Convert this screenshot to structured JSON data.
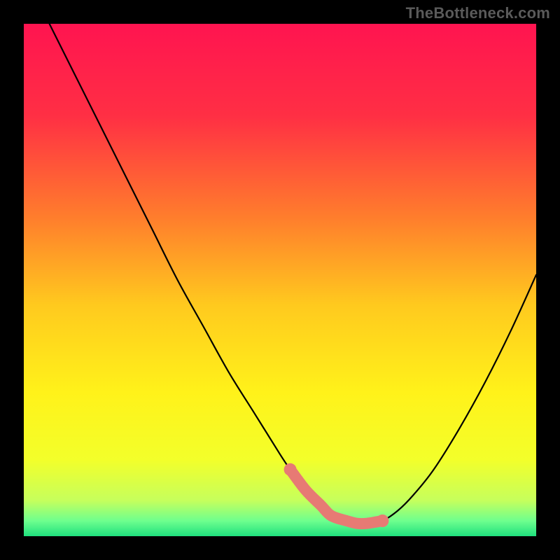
{
  "watermark": "TheBottleneck.com",
  "chart_data": {
    "type": "line",
    "title": "",
    "xlabel": "",
    "ylabel": "",
    "xlim": [
      0,
      100
    ],
    "ylim": [
      0,
      100
    ],
    "grid": false,
    "legend": false,
    "series": [
      {
        "name": "curve",
        "x": [
          5,
          10,
          15,
          20,
          25,
          30,
          35,
          40,
          45,
          50,
          52,
          55,
          58,
          60,
          63,
          65,
          67,
          70,
          73,
          76,
          80,
          85,
          90,
          95,
          100
        ],
        "values": [
          100,
          90,
          80,
          70,
          60,
          50,
          41,
          32,
          24,
          16,
          13,
          9,
          6,
          4,
          3,
          2.5,
          2.5,
          3,
          5,
          8,
          13,
          21,
          30,
          40,
          51
        ]
      }
    ],
    "highlight_range_x": [
      52,
      70
    ],
    "highlight_style": "thick-salmon-marker",
    "background_gradient": {
      "stops": [
        {
          "offset": 0.0,
          "color": "#ff1450"
        },
        {
          "offset": 0.18,
          "color": "#ff2f44"
        },
        {
          "offset": 0.38,
          "color": "#ff7e2c"
        },
        {
          "offset": 0.55,
          "color": "#ffca1e"
        },
        {
          "offset": 0.72,
          "color": "#fff21a"
        },
        {
          "offset": 0.85,
          "color": "#f3ff2a"
        },
        {
          "offset": 0.93,
          "color": "#c6ff5c"
        },
        {
          "offset": 0.97,
          "color": "#6eff8e"
        },
        {
          "offset": 1.0,
          "color": "#1fe07e"
        }
      ]
    }
  }
}
